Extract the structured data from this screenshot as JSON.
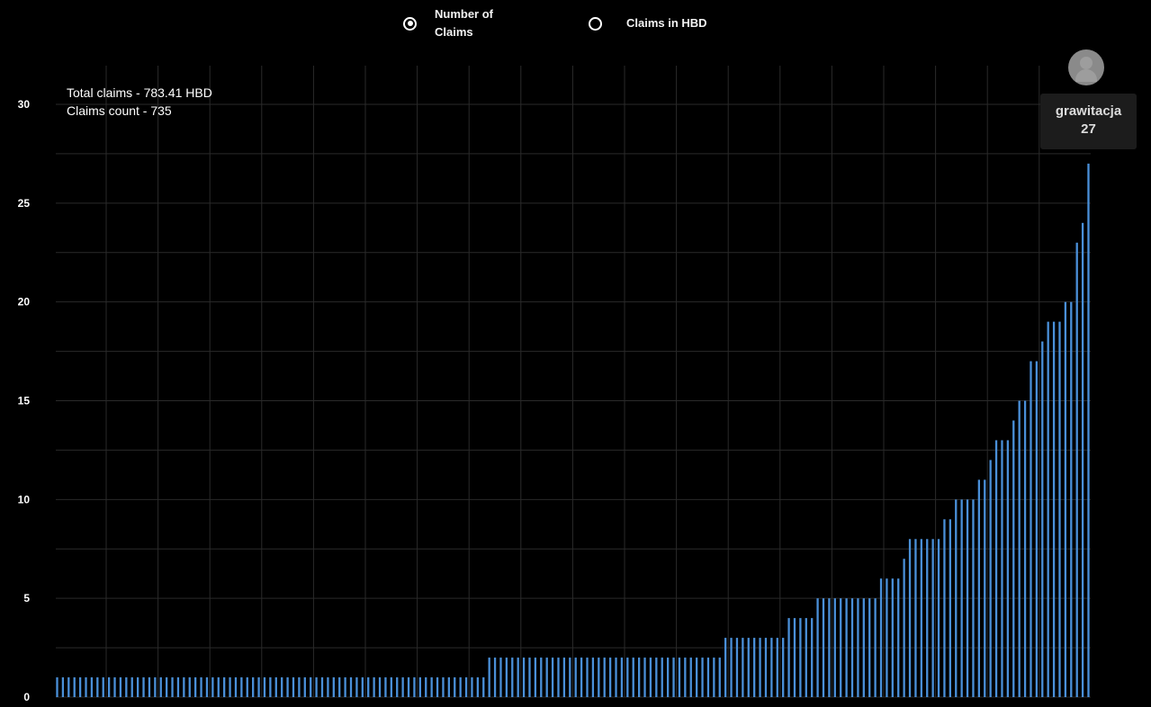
{
  "legend": {
    "options": [
      {
        "label": "Number of\nClaims",
        "selected": true
      },
      {
        "label": "Claims in HBD",
        "selected": false
      }
    ]
  },
  "summary": {
    "total_claims": "Total claims - 783.41 HBD",
    "claims_count": "Claims count - 735"
  },
  "tooltip": {
    "name": "grawitacja",
    "value": "27",
    "avatar_icon": "user-avatar-icon"
  },
  "colors": {
    "background": "#000000",
    "bar": "#4a90d9",
    "grid": "#2a2a2a",
    "text": "#ffffff"
  },
  "chart_data": {
    "type": "bar",
    "title": "",
    "xlabel": "",
    "ylabel": "",
    "ylim": [
      0,
      30
    ],
    "yticks": [
      "0",
      "5",
      "10",
      "15",
      "20",
      "25",
      "30"
    ],
    "grid": true,
    "legend_position": "top",
    "series": [
      {
        "values": [
          1,
          1,
          1,
          1,
          1,
          1,
          1,
          1,
          1,
          1,
          1,
          1,
          1,
          1,
          1,
          1,
          1,
          1,
          1,
          1,
          1,
          1,
          1,
          1,
          1,
          1,
          1,
          1,
          1,
          1,
          1,
          1,
          1,
          1,
          1,
          1,
          1,
          1,
          1,
          1,
          1,
          1,
          1,
          1,
          1,
          1,
          1,
          1,
          1,
          1,
          1,
          1,
          1,
          1,
          1,
          1,
          1,
          1,
          1,
          1,
          1,
          1,
          1,
          1,
          1,
          1,
          1,
          1,
          1,
          1,
          1,
          1,
          1,
          1,
          1,
          2,
          2,
          2,
          2,
          2,
          2,
          2,
          2,
          2,
          2,
          2,
          2,
          2,
          2,
          2,
          2,
          2,
          2,
          2,
          2,
          2,
          2,
          2,
          2,
          2,
          2,
          2,
          2,
          2,
          2,
          2,
          2,
          2,
          2,
          2,
          2,
          2,
          2,
          2,
          2,
          2,
          3,
          3,
          3,
          3,
          3,
          3,
          3,
          3,
          3,
          3,
          3,
          4,
          4,
          4,
          4,
          4,
          5,
          5,
          5,
          5,
          5,
          5,
          5,
          5,
          5,
          5,
          5,
          6,
          6,
          6,
          6,
          7,
          8,
          8,
          8,
          8,
          8,
          8,
          9,
          9,
          10,
          10,
          10,
          10,
          11,
          11,
          12,
          13,
          13,
          13,
          14,
          15,
          15,
          17,
          17,
          18,
          19,
          19,
          19,
          20,
          20,
          23,
          24,
          27
        ]
      }
    ],
    "highlighted_bar": {
      "label": "grawitacja",
      "value": 27
    }
  }
}
